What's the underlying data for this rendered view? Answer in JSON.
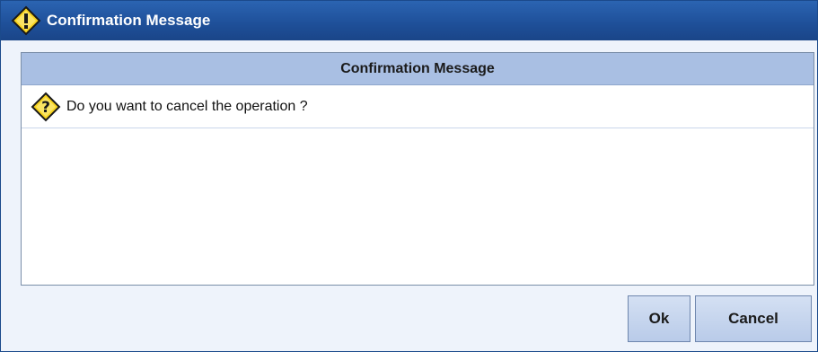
{
  "window": {
    "title": "Confirmation Message",
    "title_icon": "warning-icon"
  },
  "panel": {
    "header": "Confirmation Message",
    "message_icon": "question-icon",
    "message": "Do you want to cancel the operation ?"
  },
  "buttons": {
    "ok_label": "Ok",
    "cancel_label": "Cancel"
  },
  "colors": {
    "titlebar": "#1e4f98",
    "panel_header": "#a9bfe3",
    "icon_yellow": "#f7d21c"
  }
}
